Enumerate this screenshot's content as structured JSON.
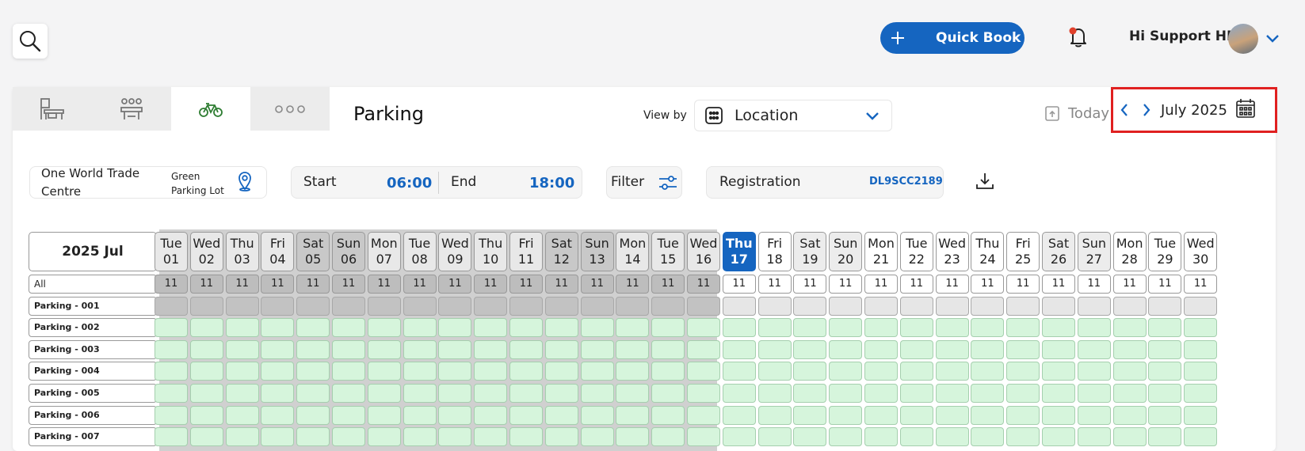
{
  "header": {
    "quick_book_label": "Quick Book",
    "greeting": "Hi Support HH"
  },
  "toolbar": {
    "title": "Parking",
    "view_by_label": "View by",
    "view_by_value": "Location",
    "today_label": "Today",
    "month_label": "July 2025"
  },
  "filters": {
    "location_main": "One World Trade Centre",
    "location_sub": "Green Parking Lot",
    "start_label": "Start",
    "start_value": "06:00",
    "end_label": "End",
    "end_value": "18:00",
    "filter_label": "Filter",
    "registration_label": "Registration",
    "registration_value": "DL9SCC2189"
  },
  "grid": {
    "month_header": "2025 Jul",
    "all_label": "All",
    "days": [
      {
        "dow": "Tue",
        "d": "01"
      },
      {
        "dow": "Wed",
        "d": "02"
      },
      {
        "dow": "Thu",
        "d": "03"
      },
      {
        "dow": "Fri",
        "d": "04"
      },
      {
        "dow": "Sat",
        "d": "05"
      },
      {
        "dow": "Sun",
        "d": "06"
      },
      {
        "dow": "Mon",
        "d": "07"
      },
      {
        "dow": "Tue",
        "d": "08"
      },
      {
        "dow": "Wed",
        "d": "09"
      },
      {
        "dow": "Thu",
        "d": "10"
      },
      {
        "dow": "Fri",
        "d": "11"
      },
      {
        "dow": "Sat",
        "d": "12"
      },
      {
        "dow": "Sun",
        "d": "13"
      },
      {
        "dow": "Mon",
        "d": "14"
      },
      {
        "dow": "Tue",
        "d": "15"
      },
      {
        "dow": "Wed",
        "d": "16"
      },
      {
        "dow": "Thu",
        "d": "17"
      },
      {
        "dow": "Fri",
        "d": "18"
      },
      {
        "dow": "Sat",
        "d": "19"
      },
      {
        "dow": "Sun",
        "d": "20"
      },
      {
        "dow": "Mon",
        "d": "21"
      },
      {
        "dow": "Tue",
        "d": "22"
      },
      {
        "dow": "Wed",
        "d": "23"
      },
      {
        "dow": "Thu",
        "d": "24"
      },
      {
        "dow": "Fri",
        "d": "25"
      },
      {
        "dow": "Sat",
        "d": "26"
      },
      {
        "dow": "Sun",
        "d": "27"
      },
      {
        "dow": "Mon",
        "d": "28"
      },
      {
        "dow": "Tue",
        "d": "29"
      },
      {
        "dow": "Wed",
        "d": "30"
      }
    ],
    "today_day": "17",
    "count_value": "11",
    "rows": [
      "Parking - 001",
      "Parking - 002",
      "Parking - 003",
      "Parking - 004",
      "Parking - 005",
      "Parking - 006",
      "Parking - 007"
    ]
  },
  "colors": {
    "accent": "#1565c0",
    "highlight_border": "#e02020",
    "available": "#d6f5dc",
    "unavailable": "#c2c2c2"
  }
}
